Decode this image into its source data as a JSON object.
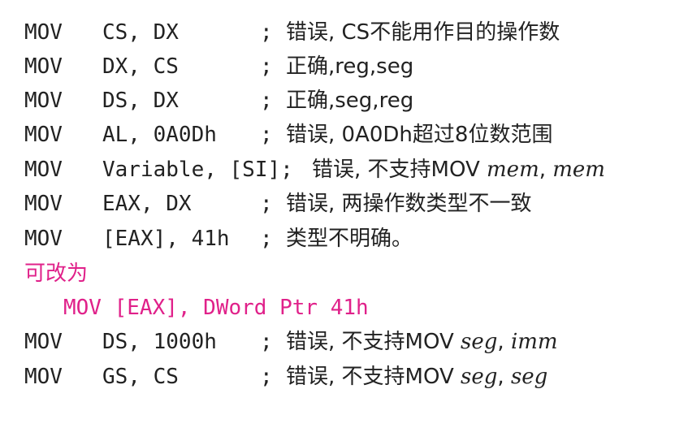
{
  "lines": [
    {
      "op": "MOV",
      "args": "CS, DX",
      "semi": ";",
      "comment": "错误, CS不能用作目的操作数"
    },
    {
      "op": "MOV",
      "args": "DX, CS",
      "semi": ";",
      "comment": "正确,reg,seg"
    },
    {
      "op": "MOV",
      "args": "DS, DX",
      "semi": ";",
      "comment": "正确,seg,reg"
    },
    {
      "op": "MOV",
      "args": "AL, 0A0Dh",
      "semi": ";",
      "comment": "错误, 0A0Dh超过8位数范围"
    },
    {
      "op": "MOV",
      "args": "Variable, [SI];",
      "comment_pre": "错误, 不支持MOV ",
      "it1": "mem",
      "sep": ", ",
      "it2": "mem"
    },
    {
      "op": "MOV",
      "args": "EAX, DX",
      "semi": ";",
      "comment": "错误, 两操作数类型不一致"
    },
    {
      "op": "MOV",
      "args": "[EAX], 41h",
      "semi": ";",
      "comment": "类型不明确。"
    },
    {
      "op": "MOV",
      "args": "DS, 1000h",
      "semi": ";",
      "comment_pre": "错误, 不支持MOV ",
      "it1": "seg",
      "sep": ", ",
      "it2": "imm"
    },
    {
      "op": "MOV",
      "args": "GS, CS",
      "semi": ";",
      "comment_pre": "错误, 不支持MOV ",
      "it1": "seg",
      "sep": ", ",
      "it2": "seg"
    }
  ],
  "fix": {
    "heading": "可改为",
    "code": "MOV [EAX], DWord Ptr 41h"
  }
}
